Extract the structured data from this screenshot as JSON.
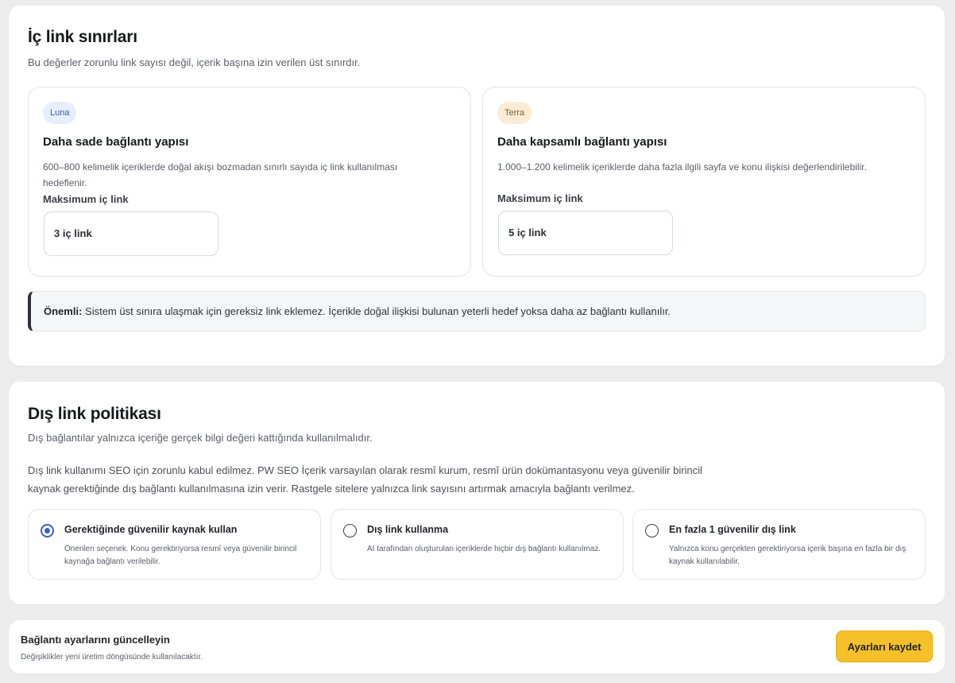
{
  "internal_links": {
    "title": "İç link sınırları",
    "subtitle": "Bu değerler zorunlu link sayısı değil, içerik başına izin verilen üst sınırdır.",
    "tiers": [
      {
        "badge": "Luna",
        "title": "Daha sade bağlantı yapısı",
        "description": "600–800 kelimelik içeriklerde doğal akışı bozmadan sınırlı sayıda iç link kullanılması hedeflenir.",
        "field_label": "Maksimum iç link",
        "field_value": "3 iç link"
      },
      {
        "badge": "Terra",
        "title": "Daha kapsamlı bağlantı yapısı",
        "description": "1.000–1.200 kelimelik içeriklerde daha fazla ilgili sayfa ve konu ilişkisi değerlendirilebilir.",
        "field_label": "Maksimum iç link",
        "field_value": "5 iç link"
      }
    ],
    "note_label": "Önemli:",
    "note_text": " Sistem üst sınıra ulaşmak için gereksiz link eklemez. İçerikle doğal ilişkisi bulunan yeterli hedef yoksa daha az bağlantı kullanılır."
  },
  "external_links": {
    "title": "Dış link politikası",
    "subtitle": "Dış bağlantılar yalnızca içeriğe gerçek bilgi değeri kattığında kullanılmalıdır.",
    "paragraph_line1": "Dış link kullanımı SEO için zorunlu kabul edilmez. PW SEO İçerik varsayılan olarak resmî kurum, resmî ürün dokümantasyonu veya güvenilir birincil",
    "paragraph_line2": "kaynak gerektiğinde dış bağlantı kullanılmasına izin verir. Rastgele sitelere yalnızca link sayısını artırmak amacıyla bağlantı verilmez.",
    "options": [
      {
        "title": "Gerektiğinde güvenilir kaynak kullan",
        "description": "Önerilen seçenek. Konu gerektiriyorsa resmî veya güvenilir birincil kaynağa bağlantı verilebilir.",
        "selected": true
      },
      {
        "title": "Dış link kullanma",
        "description": "AI tarafından oluşturulan içeriklerde hiçbir dış bağlantı kullanılmaz.",
        "selected": false
      },
      {
        "title": "En fazla 1 güvenilir dış link",
        "description": "Yalnızca konu gerçekten gerektiriyorsa içerik başına en fazla bir dış kaynak kullanılabilir.",
        "selected": false
      }
    ]
  },
  "footer": {
    "title": "Bağlantı ayarlarını güncelleyin",
    "subtitle": "Değişiklikler yeni üretim döngüsünde kullanılacaktır.",
    "save_label": "Ayarları kaydet"
  },
  "colors": {
    "accent": "#3d5fc4",
    "save_button": "#f5c02a",
    "page_background": "#ececec"
  }
}
